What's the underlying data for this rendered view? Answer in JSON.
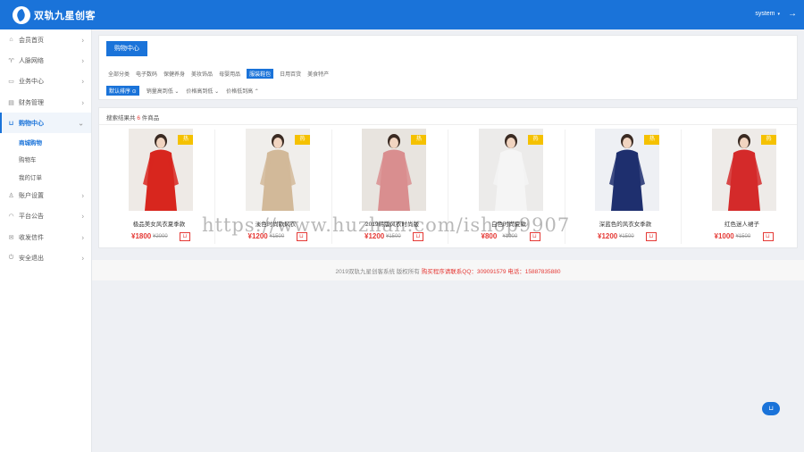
{
  "header": {
    "logo_text": "双轨九星创客",
    "user": "system",
    "user_caret": "▾",
    "logout_icon": "→"
  },
  "sidebar": {
    "arrow_right": "›",
    "arrow_down": "⌄",
    "items": [
      {
        "label": "会员首页",
        "icon": "⌂"
      },
      {
        "label": "人脉网络",
        "icon": "♈"
      },
      {
        "label": "业务中心",
        "icon": "▭"
      },
      {
        "label": "财务管理",
        "icon": "▤"
      },
      {
        "label": "购物中心",
        "icon": "⊔"
      },
      {
        "label": "账户设置",
        "icon": "♙"
      },
      {
        "label": "平台公告",
        "icon": "◠"
      },
      {
        "label": "收发信件",
        "icon": "✉"
      },
      {
        "label": "安全退出",
        "icon": "⏻"
      }
    ],
    "subitems": [
      "商城购物",
      "购物车",
      "我的订单"
    ]
  },
  "filter": {
    "page_tab": "购物中心",
    "categories": [
      "全部分类",
      "电子数码",
      "保健养身",
      "美妆饰品",
      "母婴用品",
      "服装鞋包",
      "日用百货",
      "美食特产"
    ],
    "active_category": 5,
    "sorts": [
      "默认排序 ⊙",
      "销量高到低 ⌄",
      "价格高到低 ⌄",
      "价格低到高 ⌃"
    ]
  },
  "results": {
    "prefix": "搜索结果共",
    "count": "6",
    "suffix": "件商品"
  },
  "products": [
    {
      "name": "极品美女风衣夏季款",
      "price": "¥1800",
      "old_price": "¥2000",
      "badge": "热",
      "coat": "#d8261e",
      "bg": "#eeeae6"
    },
    {
      "name": "淡色时尚款风衣",
      "price": "¥1200",
      "old_price": "¥1500",
      "badge": "热",
      "coat": "#d2b999",
      "bg": "#f0eeeb"
    },
    {
      "name": "2019韩版风衣时尚版",
      "price": "¥1200",
      "old_price": "¥1500",
      "badge": "热",
      "coat": "#d98e8f",
      "bg": "#e8e4df"
    },
    {
      "name": "白色时尚夏款",
      "price": "¥800",
      "old_price": "¥1000",
      "badge": "热",
      "coat": "#f5f5f5",
      "bg": "#ecebea"
    },
    {
      "name": "深蓝色的风衣女季款",
      "price": "¥1200",
      "old_price": "¥1500",
      "badge": "热",
      "coat": "#1e2f6e",
      "bg": "#eef0f4"
    },
    {
      "name": "红色迷人裙子",
      "price": "¥1000",
      "old_price": "¥1500",
      "badge": "热",
      "coat": "#d42a2a",
      "bg": "#eeebe8"
    }
  ],
  "cart_icon": "⊔",
  "footer": {
    "text": "2019双轨九星创客系统 版权所有",
    "contact": "购买程序请联系QQ：309091579 电话：15887835880"
  },
  "watermark": "https://www.huzhan.com/ishop9907",
  "float_button_icon": "⊔",
  "colors": {
    "primary": "#1a73d9",
    "price": "#e53935",
    "badge": "#f5c100"
  }
}
